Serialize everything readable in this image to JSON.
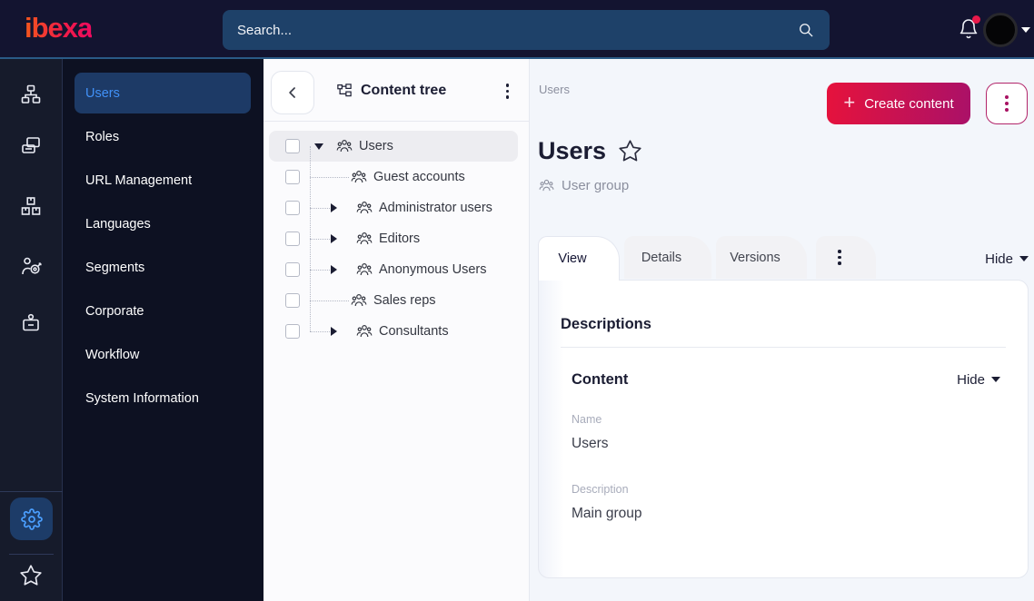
{
  "topbar": {
    "logo_text": "ibexa",
    "search_placeholder": "Search...",
    "icons": [
      "bell-icon",
      "avatar",
      "caret-down-icon"
    ],
    "notification_dot": true
  },
  "icon_rail": {
    "icons": [
      "sitemap-icon",
      "pages-icon",
      "packages-icon",
      "personalization-icon",
      "badge-icon",
      "settings-icon",
      "star-icon"
    ],
    "active_icon": "settings-icon"
  },
  "sidebar": {
    "items": [
      {
        "label": "Users",
        "active": true
      },
      {
        "label": "Roles",
        "active": false
      },
      {
        "label": "URL Management",
        "active": false
      },
      {
        "label": "Languages",
        "active": false
      },
      {
        "label": "Segments",
        "active": false
      },
      {
        "label": "Corporate",
        "active": false
      },
      {
        "label": "Workflow",
        "active": false
      },
      {
        "label": "System Information",
        "active": false
      }
    ]
  },
  "content_tree": {
    "title": "Content tree",
    "items": [
      {
        "label": "Users",
        "level": 0,
        "expanded": true,
        "selected": true,
        "icon": "user-group-icon"
      },
      {
        "label": "Guest accounts",
        "level": 1,
        "has_children": false,
        "icon": "user-group-icon"
      },
      {
        "label": "Administrator users",
        "level": 1,
        "has_children": true,
        "icon": "user-group-icon"
      },
      {
        "label": "Editors",
        "level": 1,
        "has_children": true,
        "icon": "user-group-icon"
      },
      {
        "label": "Anonymous Users",
        "level": 1,
        "has_children": true,
        "icon": "user-group-icon"
      },
      {
        "label": "Sales reps",
        "level": 1,
        "has_children": false,
        "icon": "user-group-icon"
      },
      {
        "label": "Consultants",
        "level": 1,
        "has_children": true,
        "icon": "user-group-icon"
      }
    ]
  },
  "main": {
    "breadcrumb": "Users",
    "create_button_label": "Create content",
    "title": "Users",
    "content_type": "User group",
    "tabs": [
      {
        "label": "View",
        "active": true
      },
      {
        "label": "Details",
        "active": false
      },
      {
        "label": "Versions",
        "active": false
      }
    ],
    "hide_toggle_label": "Hide",
    "card": {
      "section_title": "Descriptions",
      "subsection_title": "Content",
      "subsection_toggle_label": "Hide",
      "fields": [
        {
          "label": "Name",
          "value": "Users"
        },
        {
          "label": "Description",
          "value": "Main group"
        }
      ]
    }
  },
  "colors": {
    "topbar_bg": "#131430",
    "sidebar_bg": "#0d1122",
    "accent_blue": "#4191f7",
    "brand_gradient_start": "#e6123c",
    "brand_gradient_end": "#aa1168",
    "notification_red": "#e8194a",
    "logo_gradient_start": "#f4581c",
    "logo_gradient_end": "#ee0a5f"
  }
}
